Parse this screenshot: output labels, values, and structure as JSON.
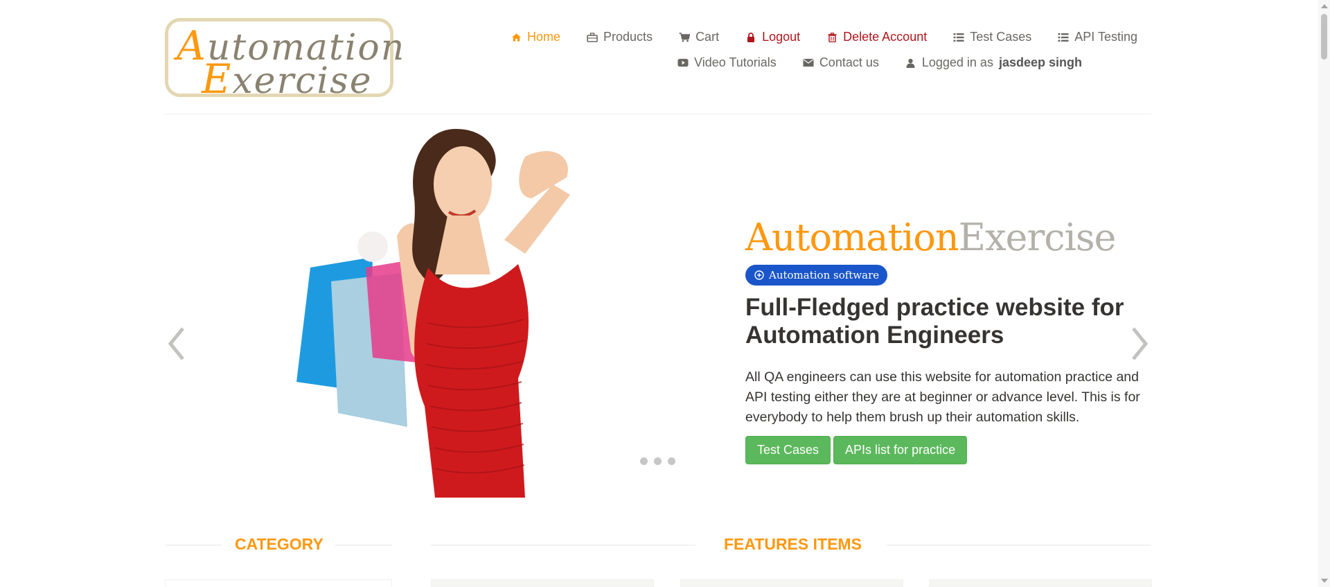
{
  "header": {
    "logo": {
      "line1_initial": "A",
      "line1_rest": "utomation",
      "line2_initial": "E",
      "line2_rest": "xercise"
    },
    "nav_row1": [
      {
        "key": "home",
        "label": "Home",
        "icon": "home-icon"
      },
      {
        "key": "products",
        "label": "Products",
        "icon": "briefcase-icon"
      },
      {
        "key": "cart",
        "label": "Cart",
        "icon": "cart-icon"
      },
      {
        "key": "logout",
        "label": "Logout",
        "icon": "lock-icon"
      },
      {
        "key": "delete",
        "label": "Delete Account",
        "icon": "trash-icon"
      },
      {
        "key": "testcases",
        "label": "Test Cases",
        "icon": "list-icon"
      },
      {
        "key": "api",
        "label": "API Testing",
        "icon": "list-icon"
      }
    ],
    "nav_row2": [
      {
        "key": "video",
        "label": "Video Tutorials",
        "icon": "youtube-icon"
      },
      {
        "key": "contact",
        "label": "Contact us",
        "icon": "envelope-icon"
      }
    ],
    "logged_in": {
      "prefix": "Logged in as",
      "user": "jasdeep singh",
      "icon": "user-icon"
    }
  },
  "hero": {
    "brand_a": "Automation",
    "brand_b": "Exercise",
    "badge": "Automation software",
    "heading_line1": "Full-Fledged practice website for",
    "heading_line2": "Automation Engineers",
    "paragraph": "All QA engineers can use this website for automation practice and API testing either they are at beginner or advance level. This is for everybody to help them brush up their automation skills.",
    "btn_test_cases": "Test Cases",
    "btn_apis": "APIs list for practice",
    "active_slide": 1,
    "slide_count": 3
  },
  "sections": {
    "category": "CATEGORY",
    "features": "FEATURES ITEMS"
  },
  "colors": {
    "accent": "#fe980f",
    "danger": "#b0161c",
    "success": "#5cb85c",
    "badge": "#1a56c9"
  }
}
